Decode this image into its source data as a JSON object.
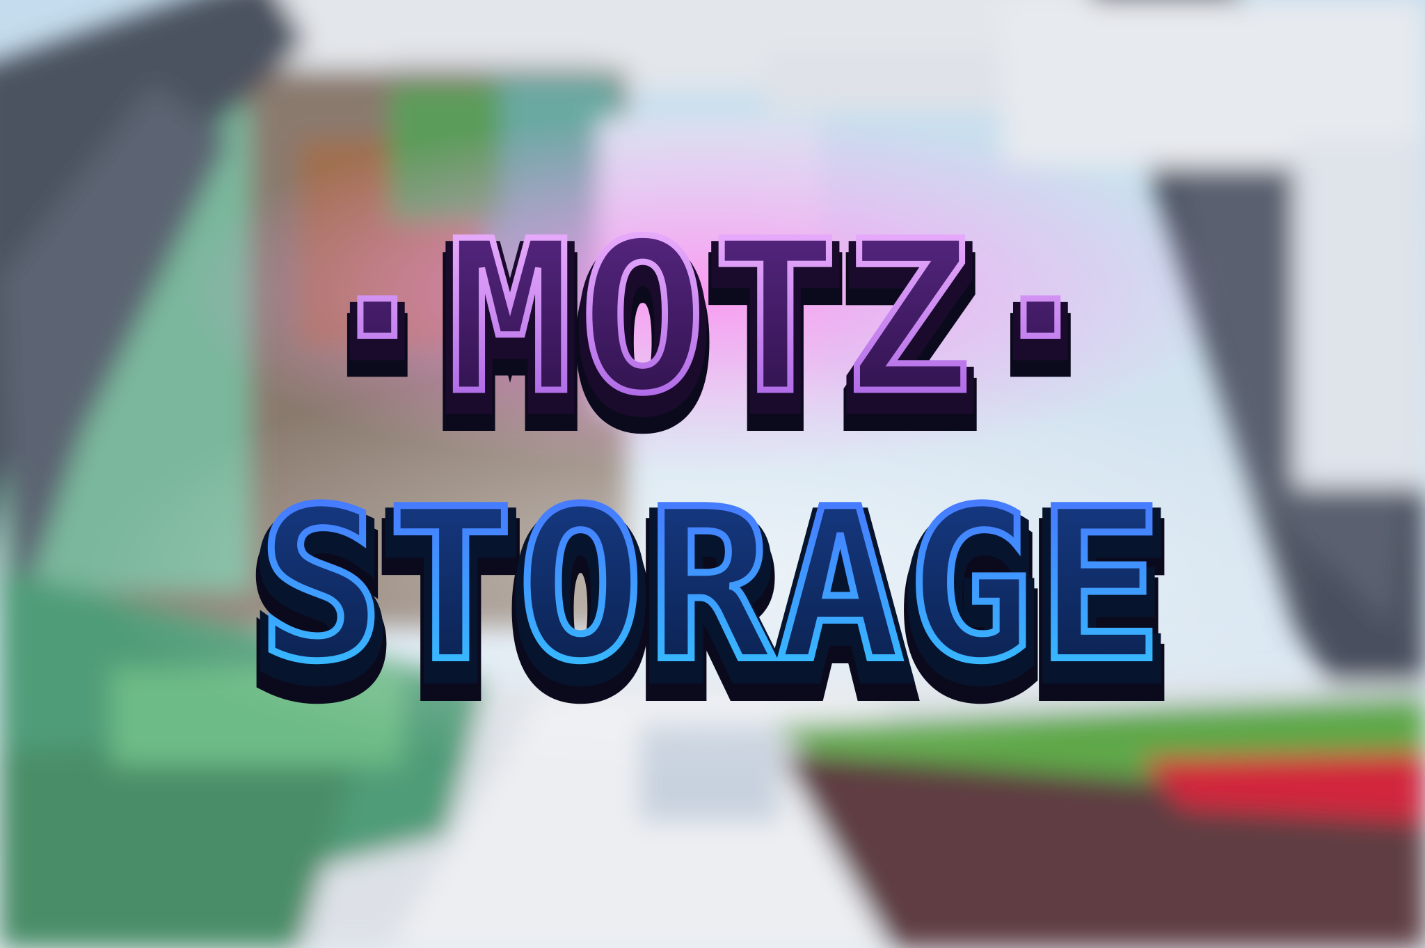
{
  "logo": {
    "line1": "·MOTZ·",
    "line2": "STORAGE"
  },
  "colors": {
    "sky": "#cfe2f2",
    "snow": "#e9ecf1",
    "stone_dark": "#4c5260",
    "grass": "#5fa84a",
    "leaves": "#3f9c67",
    "red_flower": "#d2283c",
    "purple_face": "#3a1758",
    "purple_edge": "#e9a6ff",
    "blue_face": "#0f2a5e",
    "blue_edge": "#3fc3ff",
    "outline": "#0b0a1c",
    "pink_glow": "#ff8ef0"
  }
}
